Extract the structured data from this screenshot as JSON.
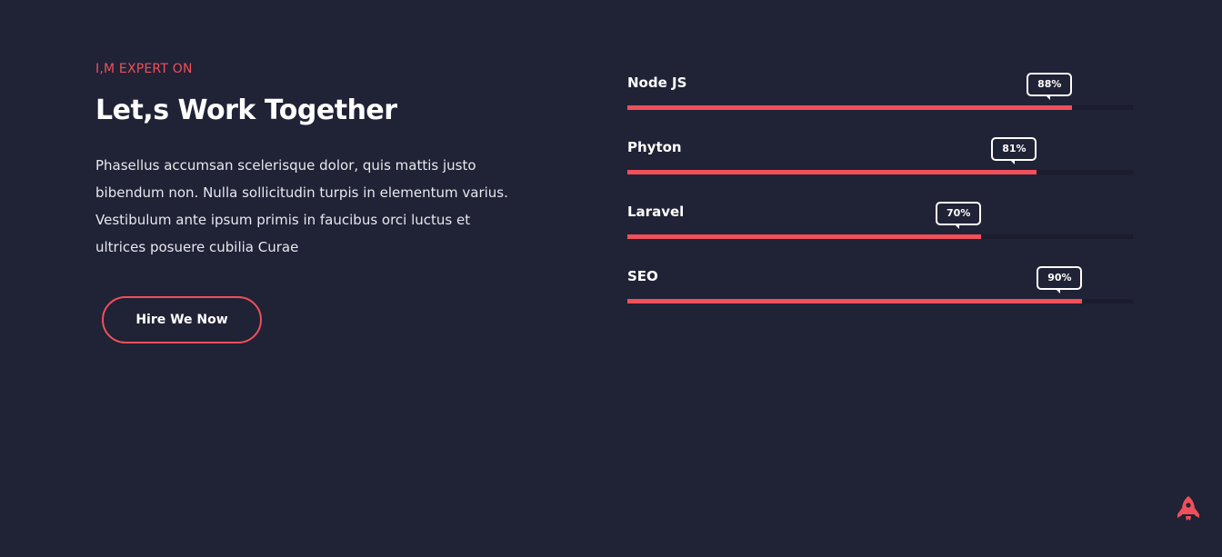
{
  "intro": {
    "eyebrow": "I,M EXPERT ON",
    "title": "Let,s Work Together",
    "description": "Phasellus accumsan scelerisque dolor, quis mattis justo bibendum non. Nulla sollicitudin turpis in elementum varius. Vestibulum ante ipsum primis in faucibus orci luctus et ultrices posuere cubilia Curae",
    "button_label": "Hire We Now"
  },
  "skills": [
    {
      "name": "Node JS",
      "percent_label": "88%",
      "value": 0.88
    },
    {
      "name": "Phyton",
      "percent_label": "81%",
      "value": 0.81
    },
    {
      "name": "Laravel",
      "percent_label": "70%",
      "value": 0.7
    },
    {
      "name": "SEO",
      "percent_label": "90%",
      "value": 0.9
    }
  ],
  "colors": {
    "background": "#202236",
    "accent": "#f0505a",
    "track": "#1b1d2e"
  },
  "icons": {
    "scroll_top": "rocket-icon"
  }
}
